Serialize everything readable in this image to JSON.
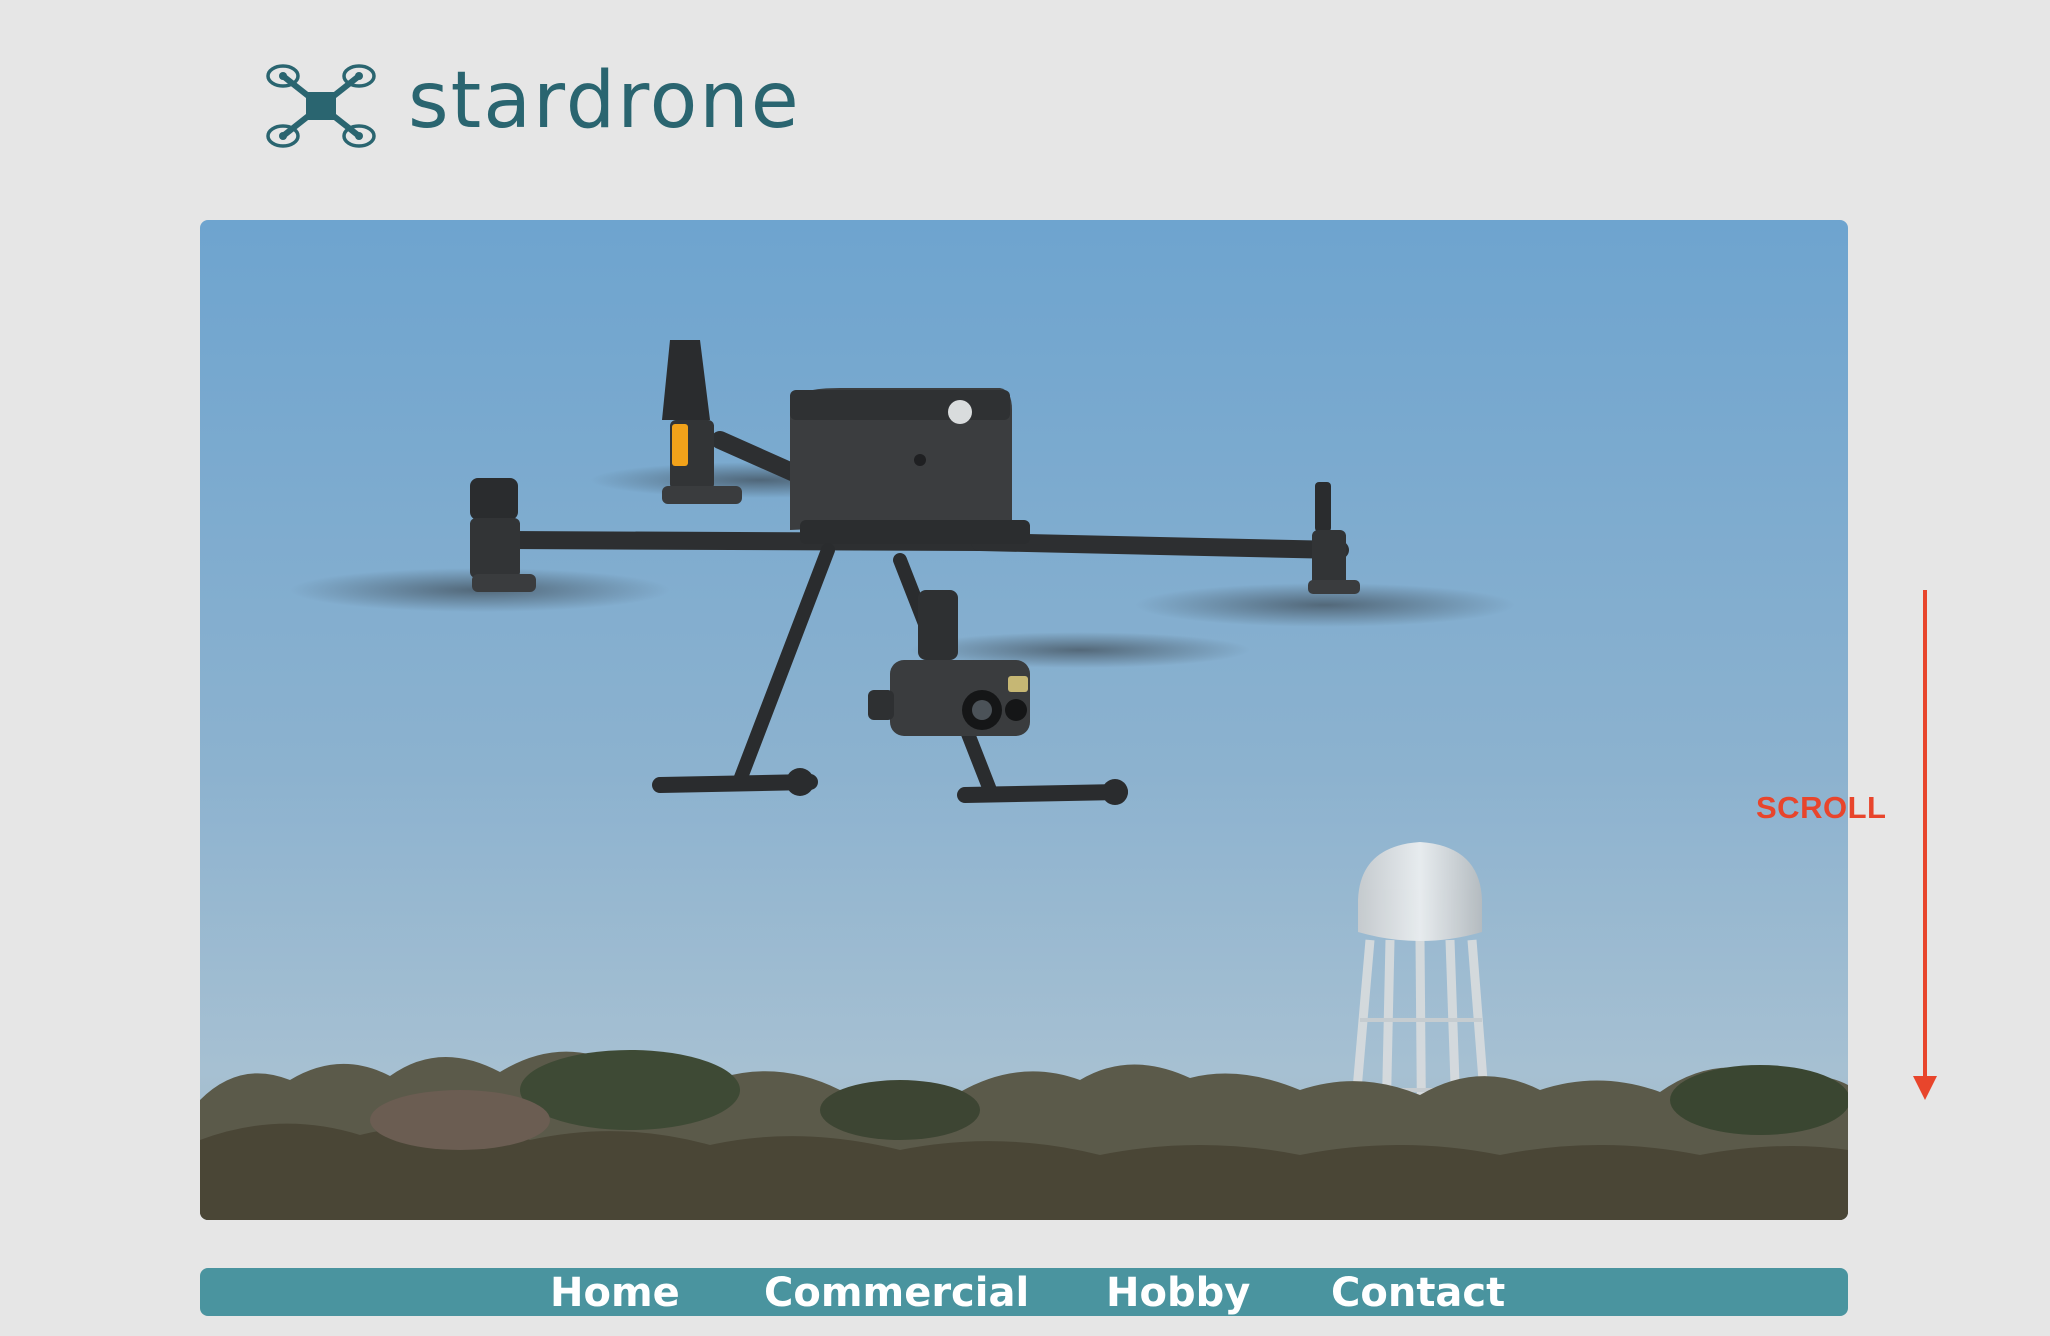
{
  "brand": {
    "name": "stardrone",
    "logo_icon": "quadcopter-icon",
    "color": "#2a6570"
  },
  "hero": {
    "image": "drone-hero-image",
    "scene": [
      "drone",
      "water-tower",
      "treeline",
      "sky"
    ]
  },
  "scroll_hint": {
    "label": "SCROLL",
    "icon": "down-arrow-icon",
    "color": "#e8452c"
  },
  "nav": {
    "background": "#4a949f",
    "items": [
      {
        "label": "Home"
      },
      {
        "label": "Commercial"
      },
      {
        "label": "Hobby"
      },
      {
        "label": "Contact"
      }
    ]
  }
}
